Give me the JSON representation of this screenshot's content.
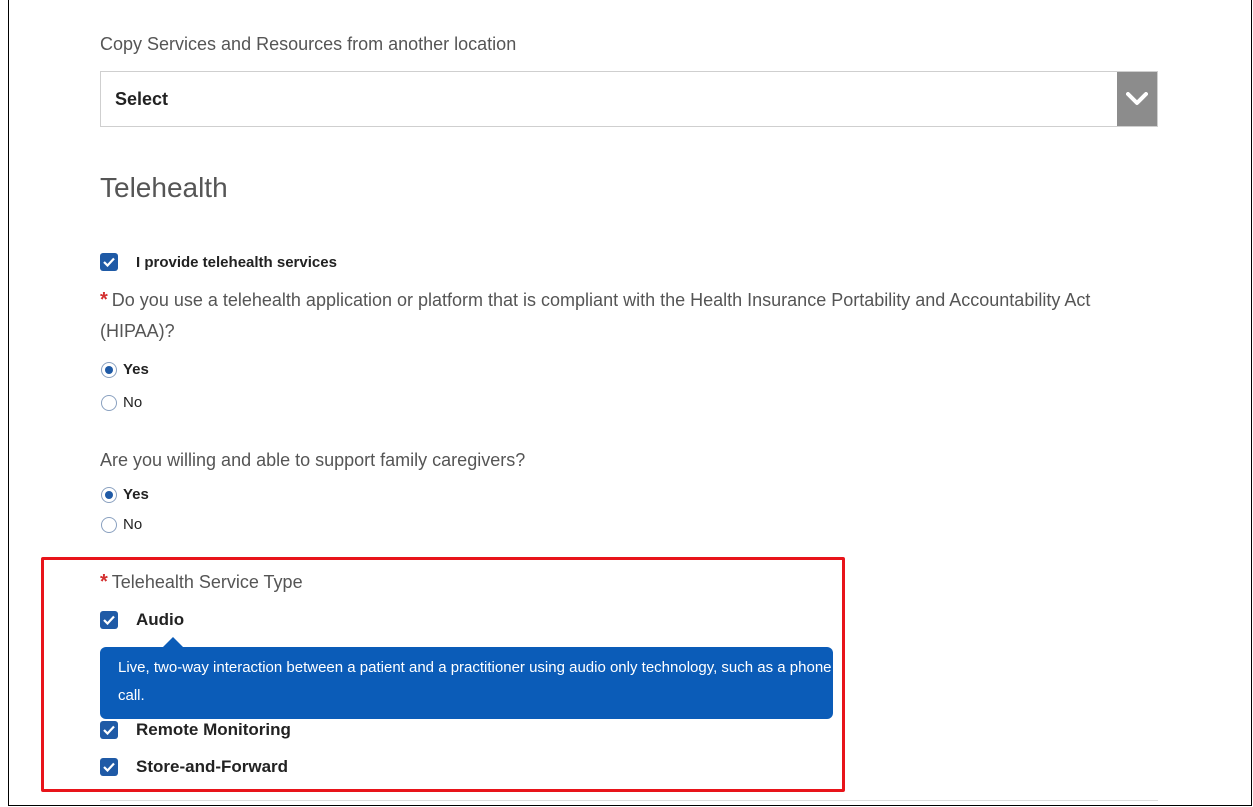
{
  "copy_section": {
    "label": "Copy Services and Resources from another location",
    "select_value": "Select"
  },
  "telehealth": {
    "title": "Telehealth",
    "provide_checkbox": "I provide telehealth services",
    "hipaa_question": "Do you use a telehealth application or platform that is compliant with the Health Insurance Portability and Accountability Act (HIPAA)?",
    "hipaa_options": [
      "Yes",
      "No"
    ],
    "hipaa_selected": "Yes",
    "caregiver_question": "Are you willing and able to support family caregivers?",
    "caregiver_options": [
      "Yes",
      "No"
    ],
    "caregiver_selected": "Yes",
    "service_type_label": "Telehealth Service Type",
    "service_types": [
      "Audio",
      "Remote Monitoring",
      "Store-and-Forward"
    ],
    "tooltip_text": "Live, two-way interaction between a patient and a practitioner using audio only technology, such as a phone call.",
    "required_marker": "*"
  },
  "colors": {
    "accent": "#1f5aa6",
    "tooltip_bg": "#0b5cb8",
    "required": "#d32f2f",
    "highlight": "#e8141a"
  }
}
